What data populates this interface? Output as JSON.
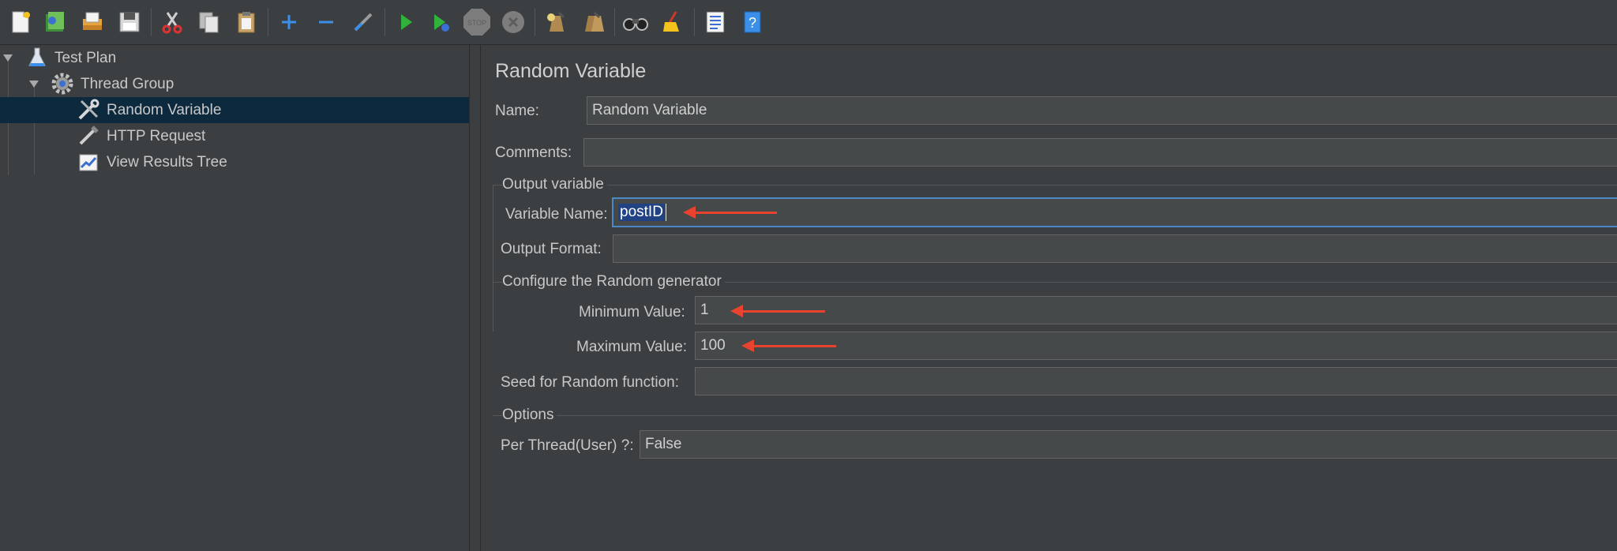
{
  "toolbar": {
    "buttons": [
      {
        "name": "new-icon"
      },
      {
        "name": "templates-icon"
      },
      {
        "name": "open-icon"
      },
      {
        "name": "save-icon"
      },
      {
        "name": "cut-icon"
      },
      {
        "name": "copy-icon"
      },
      {
        "name": "paste-icon"
      },
      {
        "name": "expand-icon"
      },
      {
        "name": "collapse-icon"
      },
      {
        "name": "toggle-icon"
      },
      {
        "name": "start-icon"
      },
      {
        "name": "start-no-pauses-icon"
      },
      {
        "name": "stop-icon"
      },
      {
        "name": "shutdown-icon"
      },
      {
        "name": "clear-icon"
      },
      {
        "name": "clear-all-icon"
      },
      {
        "name": "search-icon"
      },
      {
        "name": "reset-search-icon"
      },
      {
        "name": "function-helper-icon"
      },
      {
        "name": "help-icon"
      }
    ],
    "stop_text": "STOP"
  },
  "tree": {
    "items": [
      {
        "label": "Test Plan",
        "icon": "flask-icon"
      },
      {
        "label": "Thread Group",
        "icon": "gear-icon"
      },
      {
        "label": "Random Variable",
        "icon": "wrench-icon",
        "selected": true
      },
      {
        "label": "HTTP Request",
        "icon": "pipette-icon"
      },
      {
        "label": "View Results Tree",
        "icon": "chart-icon"
      }
    ]
  },
  "panel": {
    "title": "Random Variable",
    "name_label": "Name:",
    "name_value": "Random Variable",
    "comments_label": "Comments:",
    "comments_value": "",
    "output_section": "Output variable",
    "variable_name_label": "Variable Name:",
    "variable_name_value": "postID",
    "output_format_label": "Output Format:",
    "output_format_value": "",
    "random_section": "Configure the Random generator",
    "min_label": "Minimum Value:",
    "min_value": "1",
    "max_label": "Maximum Value:",
    "max_value": "100",
    "seed_label": "Seed for Random function:",
    "seed_value": "",
    "options_section": "Options",
    "per_thread_label": "Per Thread(User) ?:",
    "per_thread_value": "False"
  },
  "colors": {
    "background": "#3c3f41",
    "selection": "#0d293e",
    "field": "#45494a",
    "focus": "#4a88c7",
    "annotation_arrow": "#e8432e"
  }
}
